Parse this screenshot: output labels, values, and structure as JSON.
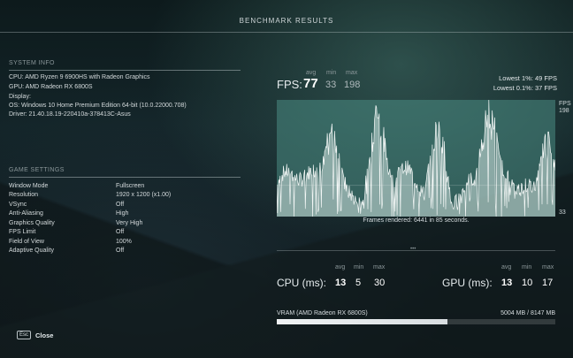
{
  "header": {
    "title": "BENCHMARK RESULTS"
  },
  "system_info": {
    "title": "SYSTEM INFO",
    "lines": [
      "CPU: AMD Ryzen 9 6900HS with Radeon Graphics",
      "GPU: AMD Radeon RX 6800S",
      "Display:",
      "OS: Windows 10 Home Premium Edition 64-bit (10.0.22000.708)",
      "Driver: 21.40.18.19-220410a-378413C-Asus"
    ]
  },
  "game_settings": {
    "title": "GAME SETTINGS",
    "rows": [
      {
        "key": "Window Mode",
        "value": "Fullscreen"
      },
      {
        "key": "Resolution",
        "value": "1920 x 1200 (x1.00)"
      },
      {
        "key": "VSync",
        "value": "Off"
      },
      {
        "key": "Anti-Aliasing",
        "value": "High"
      },
      {
        "key": "Graphics Quality",
        "value": "Very High"
      },
      {
        "key": "FPS Limit",
        "value": "Off"
      },
      {
        "key": "Field of View",
        "value": "100%"
      },
      {
        "key": "Adaptive Quality",
        "value": "Off"
      }
    ]
  },
  "fps": {
    "label": "FPS:",
    "avg_head": "avg",
    "min_head": "min",
    "max_head": "max",
    "avg": "77",
    "min": "33",
    "max": "198",
    "lowest_1": "Lowest 1%: 49 FPS",
    "lowest_01": "Lowest 0.1%: 37 FPS"
  },
  "chart": {
    "axis_label": "FPS",
    "top_value": "198",
    "bottom_value": "33",
    "frames_rendered": "Frames rendered: 6441 in 85 seconds.",
    "fill_color": "#4a8f86"
  },
  "cpu": {
    "label": "CPU (ms):",
    "avg_head": "avg",
    "min_head": "min",
    "max_head": "max",
    "avg": "13",
    "min": "5",
    "max": "30"
  },
  "gpu": {
    "label": "GPU (ms):",
    "avg_head": "avg",
    "min_head": "min",
    "max_head": "max",
    "avg": "13",
    "min": "10",
    "max": "17"
  },
  "vram": {
    "label": "VRAM (AMD Radeon RX 6800S)",
    "value": "5004 MB / 8147 MB",
    "used_fraction": 0.614
  },
  "footer": {
    "key": "Esc",
    "close_label": "Close"
  },
  "chart_data": {
    "type": "area",
    "title": "",
    "ylabel": "FPS",
    "ylim": [
      33,
      198
    ],
    "avg": 77,
    "min": 33,
    "max": 198,
    "frames": 6441,
    "seconds": 85
  }
}
